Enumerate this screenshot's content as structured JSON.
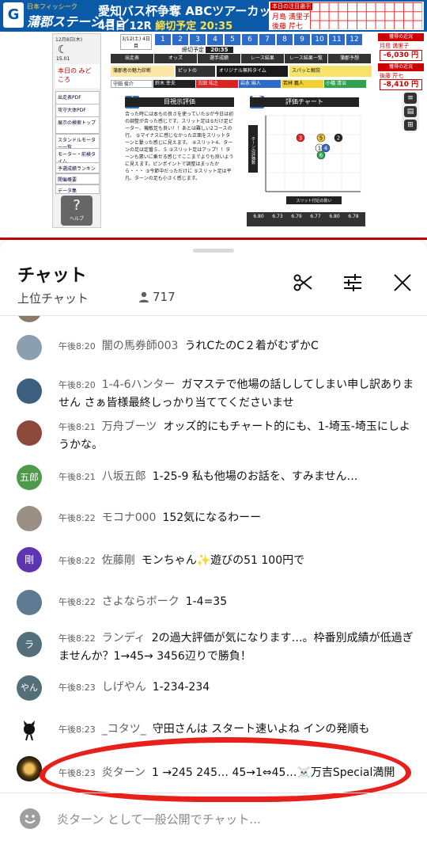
{
  "video": {
    "banner": {
      "station_sub": "日本フィッシーク",
      "station_name": "蒲郡ステーション",
      "title": "愛知バス杯争奪 ABCツアーカップ",
      "sub_prefix": "4日目 12R ",
      "sub_highlight": "締切予定 20:35",
      "top3_header": "本日の注目選手",
      "top3_name1": "月島 満里子",
      "top3_name2": "後藤 芹七"
    },
    "left_panel": {
      "date": "12月8日(木)",
      "temp": "15.01",
      "mido": "本日の みどころ",
      "items": [
        "出走表PDF",
        "攻守大体PDF",
        "展示の検索トップ",
        "スタンドルモーター一覧",
        "モーター・前検タイム",
        "予選成績ランキング",
        "開催概要",
        "データ集"
      ],
      "help": "ヘルプ"
    },
    "race_date": "3/12(土) 4日目",
    "race_numbers": [
      "1",
      "2",
      "3",
      "4",
      "5",
      "6",
      "7",
      "8",
      "9",
      "10",
      "11",
      "12"
    ],
    "deadline_label": "締切予定",
    "deadline_time": "20:35",
    "menu": [
      "出走表",
      "オッズ",
      "選手成績",
      "レース結果",
      "レース結果一覧",
      "蒲郡予想"
    ],
    "promo": [
      "蒲郡者の魅力診断",
      "ピットの",
      "オリジナル無料タイム",
      "スパッと解説"
    ],
    "racers": [
      "守田 俊介",
      "鈴木 幸夫",
      "古田 祐之",
      "岩永 麻人",
      "若林 義人",
      "小幡 清治"
    ],
    "eval_title": "目視示評価",
    "eval_text": "合った時には本もの良さを使っていた⑤が今日は初の調整が合った感じです。スリット足は⑤だけ足ピーター、機敏足も良い！！あとは難しい2コースの行。 ⑤マイナスに感じなかった正面をスリットターンと繋った感じに見えます。 ④スリット4、ターンの足は定番５、５ ②スリット足はアップ！！ターンも悪いに乗せる感じでここまでよりも良いように見えます。ピンポイントで調整はまったから・・・ ③今節中だっただけに ⑤スリット足は平凡、ターンの足も小さく感じます。",
    "chart_title": "評価チャート",
    "chart_ylabel": "ターンの評価数",
    "chart_xlabel": "スリット付近の勢い",
    "chart_points": [
      {
        "label": "3",
        "color": "#e8201c"
      },
      {
        "label": "5",
        "color": "#f2c12e"
      },
      {
        "label": "2",
        "color": "#222222"
      },
      {
        "label": "1",
        "color": "#ffffff"
      },
      {
        "label": "4",
        "color": "#2c6bc7"
      },
      {
        "label": "6",
        "color": "#2ea44f"
      }
    ],
    "odds": [
      "6.80",
      "6.73",
      "6.79",
      "6.77",
      "6.80",
      "6.78"
    ],
    "right_panel": {
      "head1": "獲得の近況",
      "name1": "月島 満里子",
      "val1": "-6,030 円",
      "head2": "獲得の近況",
      "name2": "後藤 芹七",
      "val2": "-8,410 円"
    }
  },
  "chat": {
    "title": "チャット",
    "subtitle": "上位チャット",
    "viewer_count": "717",
    "input_placeholder": "炎ターン として一般公開でチャット...",
    "messages": [
      {
        "time": "午後8:20",
        "author": "闇の馬券師003",
        "text": "うれCたのC２着がむずかC",
        "avatar_color": "#8aa0b0"
      },
      {
        "time": "午後8:20",
        "author": "1-4-6ハンター",
        "text": "ガマステで他場の話ししてしまい申し訳ありません さぁ皆様最終しっかり当ててくださいませ",
        "avatar_color": "#3b5f7f"
      },
      {
        "time": "午後8:21",
        "author": "万舟ブーツ",
        "text": "オッズ的にもチャート的にも、1-埼玉-埼玉にしようかな。",
        "avatar_color": "#8d4a3c"
      },
      {
        "time": "午後8:21",
        "author": "八坂五郎",
        "text": "1-25-9 私も他場のお話を、すみません…",
        "avatar_text": "五郎",
        "avatar_color": "#4e9a4a"
      },
      {
        "time": "午後8:22",
        "author": "モコナ000",
        "text": "152気になるわーー",
        "avatar_color": "#9a8f84"
      },
      {
        "time": "午後8:22",
        "author": "佐藤剛",
        "text_before": "モンちゃん",
        "sparkle": "✨",
        "text_after": "遊びの51 100円で",
        "avatar_text": "剛",
        "avatar_color": "#5e35b1"
      },
      {
        "time": "午後8:22",
        "author": "さよならボーク",
        "text": "1-4=35",
        "avatar_color": "#5c7a92"
      },
      {
        "time": "午後8:22",
        "author": "ランディ",
        "text": "2の過大評価が気になります…。枠番別成績が低過ぎませんか？1→45→ 3456辺りで勝負！",
        "avatar_text": "ラ",
        "avatar_color": "#546e7a"
      },
      {
        "time": "午後8:23",
        "author": "しげやん",
        "text": "1-234-234",
        "avatar_text": "やん",
        "avatar_color": "#546e7a"
      },
      {
        "time": "午後8:23",
        "author": "_コタツ_",
        "text": "守田さんは スタート速いよね インの発順も",
        "avatar_color": "#ffffff"
      },
      {
        "time": "午後8:23",
        "author": "炎ターン",
        "text_before": "1 →245 245… 45→1⇔45…",
        "skull": "☠️",
        "text_after": "万吉Special満開",
        "avatar_color": "#2b1d0e"
      }
    ]
  },
  "colors": {
    "banner_blue": "#0b5aa8",
    "annotation_red": "#e8201c",
    "chat_text": "#0f0f0f",
    "chat_meta": "#606060"
  },
  "icons": {
    "scissors": "scissors-icon",
    "tune": "tune-icon",
    "close": "close-icon",
    "person": "person-icon"
  }
}
